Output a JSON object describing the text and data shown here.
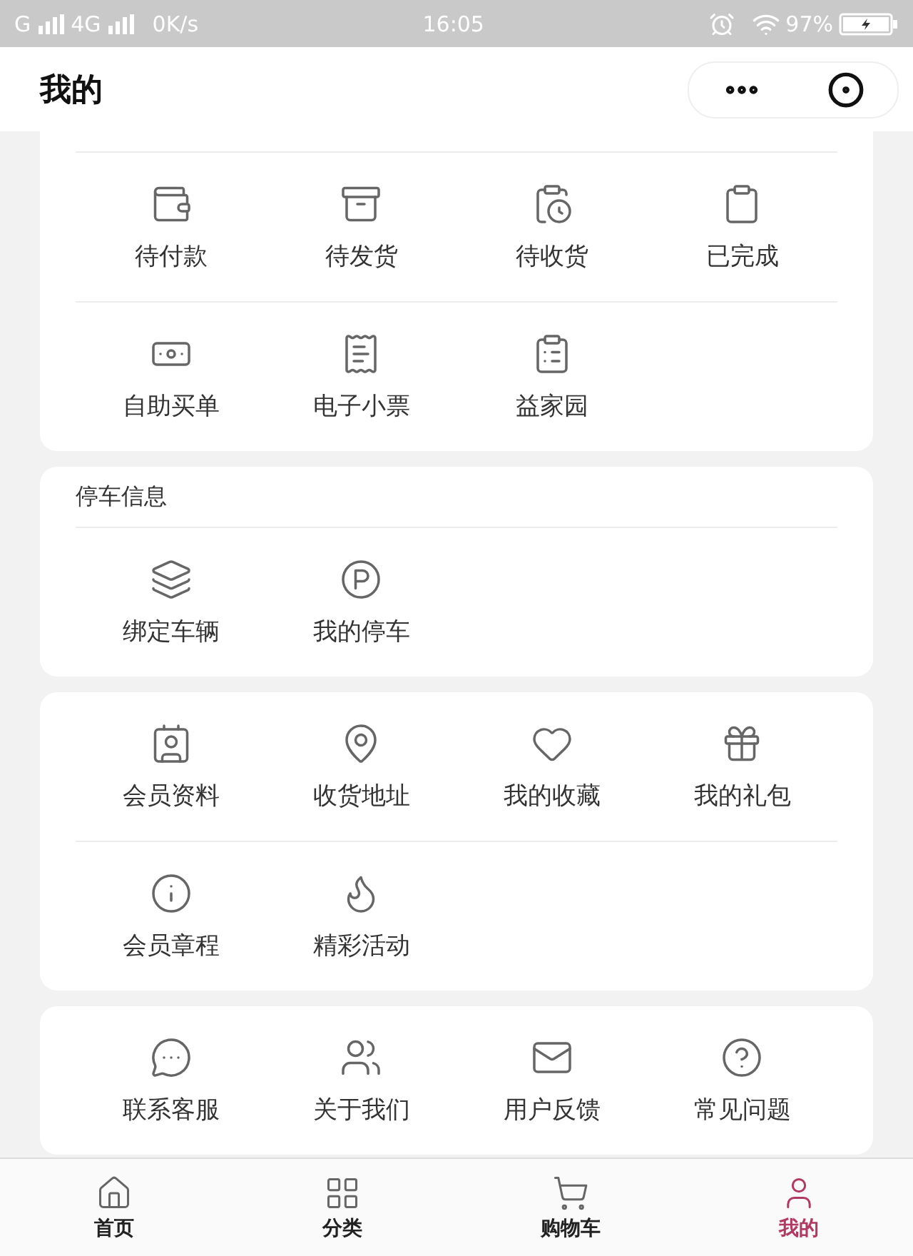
{
  "status_bar": {
    "network_1": "G",
    "network_2": "4G",
    "speed": "0K/s",
    "time": "16:05",
    "battery": "97%"
  },
  "nav_bar": {
    "title": "我的"
  },
  "sections": [
    {
      "cut_off_top": true,
      "rows": [
        [
          {
            "label": "待付款"
          },
          {
            "label": "待发货"
          },
          {
            "label": "待收货"
          },
          {
            "label": "已完成"
          }
        ],
        [
          {
            "label": "自助买单"
          },
          {
            "label": "电子小票"
          },
          {
            "label": "益家园"
          }
        ]
      ]
    },
    {
      "cut_off_top": false,
      "title": "停车信息",
      "rows": [
        [
          {
            "label": "绑定车辆"
          },
          {
            "label": "我的停车"
          }
        ]
      ]
    },
    {
      "cut_off_top": false,
      "rows": [
        [
          {
            "label": "会员资料"
          },
          {
            "label": "收货地址"
          },
          {
            "label": "我的收藏"
          },
          {
            "label": "我的礼包"
          }
        ],
        [
          {
            "label": "会员章程"
          },
          {
            "label": "精彩活动"
          }
        ]
      ]
    },
    {
      "cut_off_top": false,
      "rows": [
        [
          {
            "label": "联系客服"
          },
          {
            "label": "关于我们"
          },
          {
            "label": "用户反馈"
          },
          {
            "label": "常见问题"
          }
        ]
      ]
    }
  ],
  "tab_bar": [
    {
      "label": "首页",
      "selected": false
    },
    {
      "label": "分类",
      "selected": false
    },
    {
      "label": "购物车",
      "selected": false
    },
    {
      "label": "我的",
      "selected": true
    }
  ]
}
